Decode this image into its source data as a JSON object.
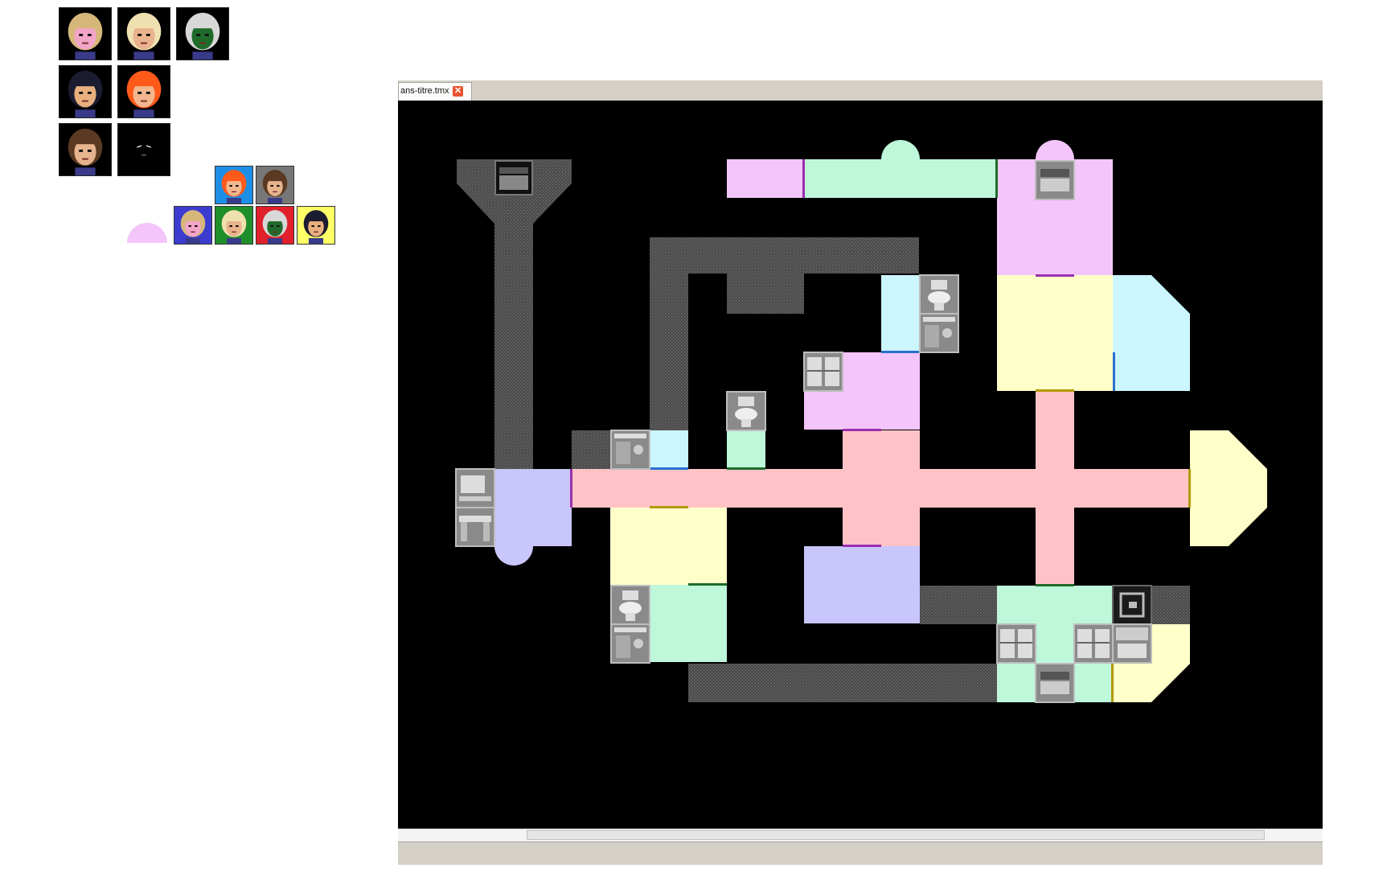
{
  "editor": {
    "tab_title": "ans-titre.tmx",
    "close_glyph": "✕"
  },
  "palette": {
    "portraits": [
      {
        "name": "blonde-pink-face",
        "hair": "#d6b77a",
        "skin": "#f3a5c8",
        "bg": "#000000"
      },
      {
        "name": "platinum-blonde",
        "hair": "#efe0b0",
        "skin": "#e8b38c",
        "bg": "#000000"
      },
      {
        "name": "hooded-green-mask",
        "hair": "#d8d8d8",
        "skin": "#1f6b2a",
        "bg": "#000000"
      },
      {
        "name": "dark-haired-boy",
        "hair": "#1c1c30",
        "skin": "#e9b07f",
        "bg": "#000000"
      },
      {
        "name": "red-haired-girl",
        "hair": "#ff5a1a",
        "skin": "#f2b78e",
        "bg": "#000000"
      },
      {
        "name": "brown-haired-boy",
        "hair": "#5a3a22",
        "skin": "#e7b48e",
        "bg": "#000000"
      },
      {
        "name": "shadow-figure",
        "hair": "#000000",
        "skin": "#000000",
        "bg": "#000000"
      }
    ],
    "mini_portraits": [
      {
        "name": "mini-red-haired-girl",
        "hair": "#ff5a1a",
        "skin": "#f2b78e",
        "bg": "#1e8fe6"
      },
      {
        "name": "mini-brown-haired-boy",
        "hair": "#5a3a22",
        "skin": "#e7b48e",
        "bg": "#777777"
      },
      {
        "name": "mini-blonde-pink-face",
        "hair": "#d6b77a",
        "skin": "#f3a5c8",
        "bg": "#3c3cd0"
      },
      {
        "name": "mini-platinum-blonde",
        "hair": "#efe0b0",
        "skin": "#e8b38c",
        "bg": "#1f8f2a"
      },
      {
        "name": "mini-hooded-green-mask",
        "hair": "#d8d8d8",
        "skin": "#1f6b2a",
        "bg": "#e0202a"
      },
      {
        "name": "mini-dark-haired-boy",
        "hair": "#1c1c30",
        "skin": "#e9b07f",
        "bg": "#ffff66"
      }
    ]
  },
  "colors": {
    "corridor": "#5b5b5b",
    "pink": "#f4c5fb",
    "mint": "#bff7da",
    "yellow": "#ffffc9",
    "cyan": "#ccf6fe",
    "lavender": "#c8c6fa",
    "salmon": "#ffc3c7",
    "background": "#000000"
  }
}
